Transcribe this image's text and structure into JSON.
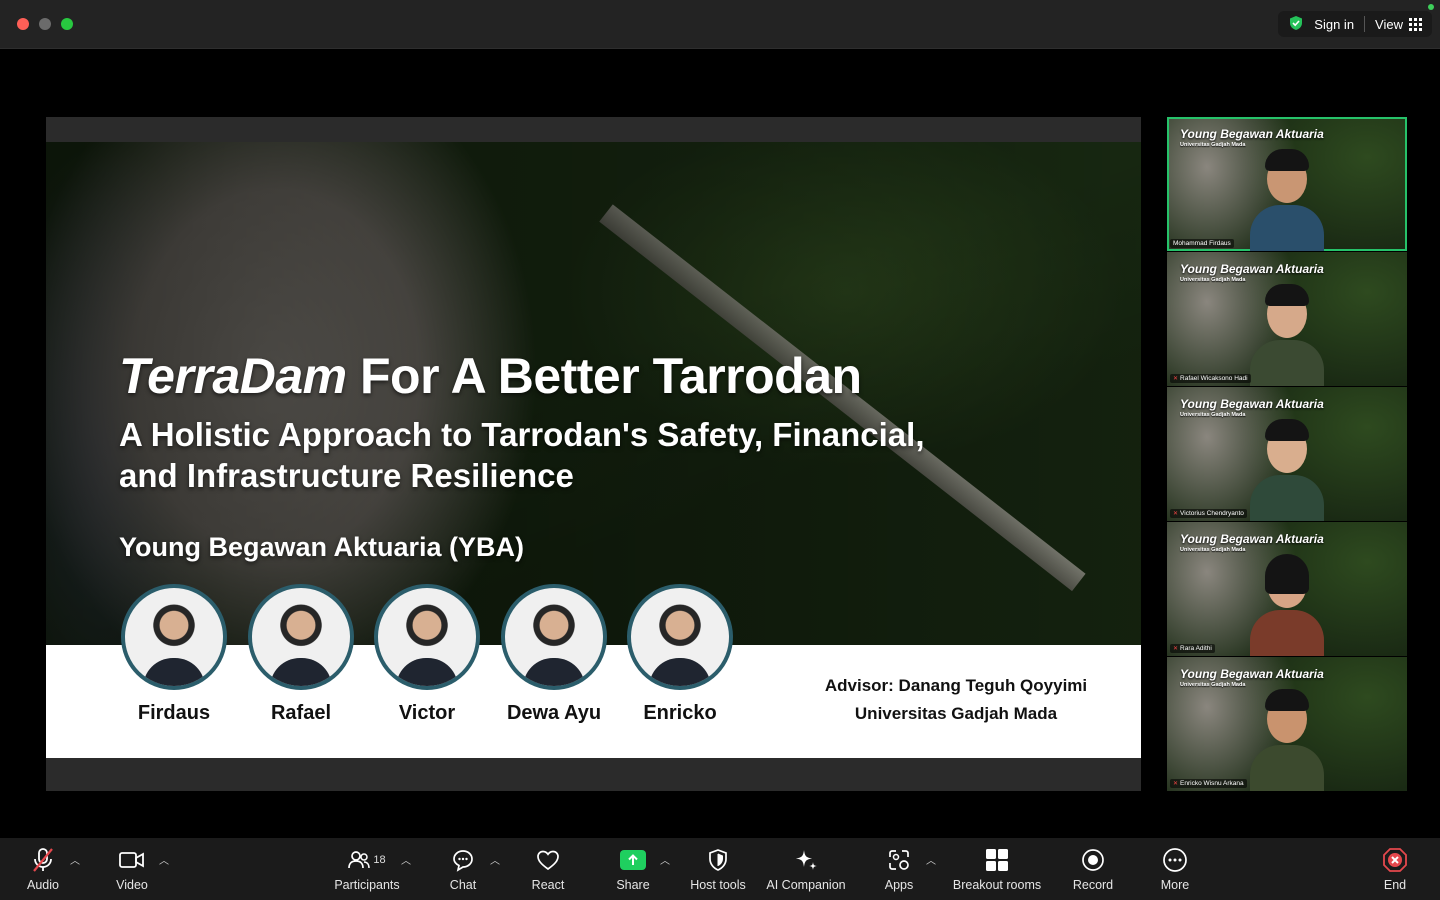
{
  "titlebar": {
    "sign_in": "Sign in",
    "view": "View"
  },
  "slide": {
    "title_italic": "TerraDam",
    "title_rest": " For A Better Tarrodan",
    "subtitle_line1": "A Holistic Approach to Tarrodan's Safety, Financial,",
    "subtitle_line2": "and Infrastructure Resilience",
    "team": "Young Begawan Aktuaria (YBA)",
    "members": [
      "Firdaus",
      "Rafael",
      "Victor",
      "Dewa Ayu",
      "Enricko"
    ],
    "advisor": "Advisor: Danang Teguh Qoyyimi",
    "university": "Universitas Gadjah Mada"
  },
  "gallery": {
    "bg_title": "Young Begawan Aktuaria",
    "bg_subtitle": "Universitas Gadjah Mada",
    "participants": [
      "Mohammad Firdaus",
      "Rafael Wicaksono Hadi",
      "Victorius Chendryanto",
      "Rara Adithi",
      "Enricko Wisnu Arkana"
    ]
  },
  "toolbar": {
    "audio": "Audio",
    "video": "Video",
    "participants": "Participants",
    "participant_count": "18",
    "chat": "Chat",
    "react": "React",
    "share": "Share",
    "host_tools": "Host tools",
    "ai_companion": "AI Companion",
    "apps": "Apps",
    "breakout_rooms": "Breakout rooms",
    "record": "Record",
    "more": "More",
    "end": "End"
  },
  "colors": {
    "accent_green": "#26c26a",
    "end_red": "#e5484d",
    "share_green": "#1fcf5f"
  }
}
